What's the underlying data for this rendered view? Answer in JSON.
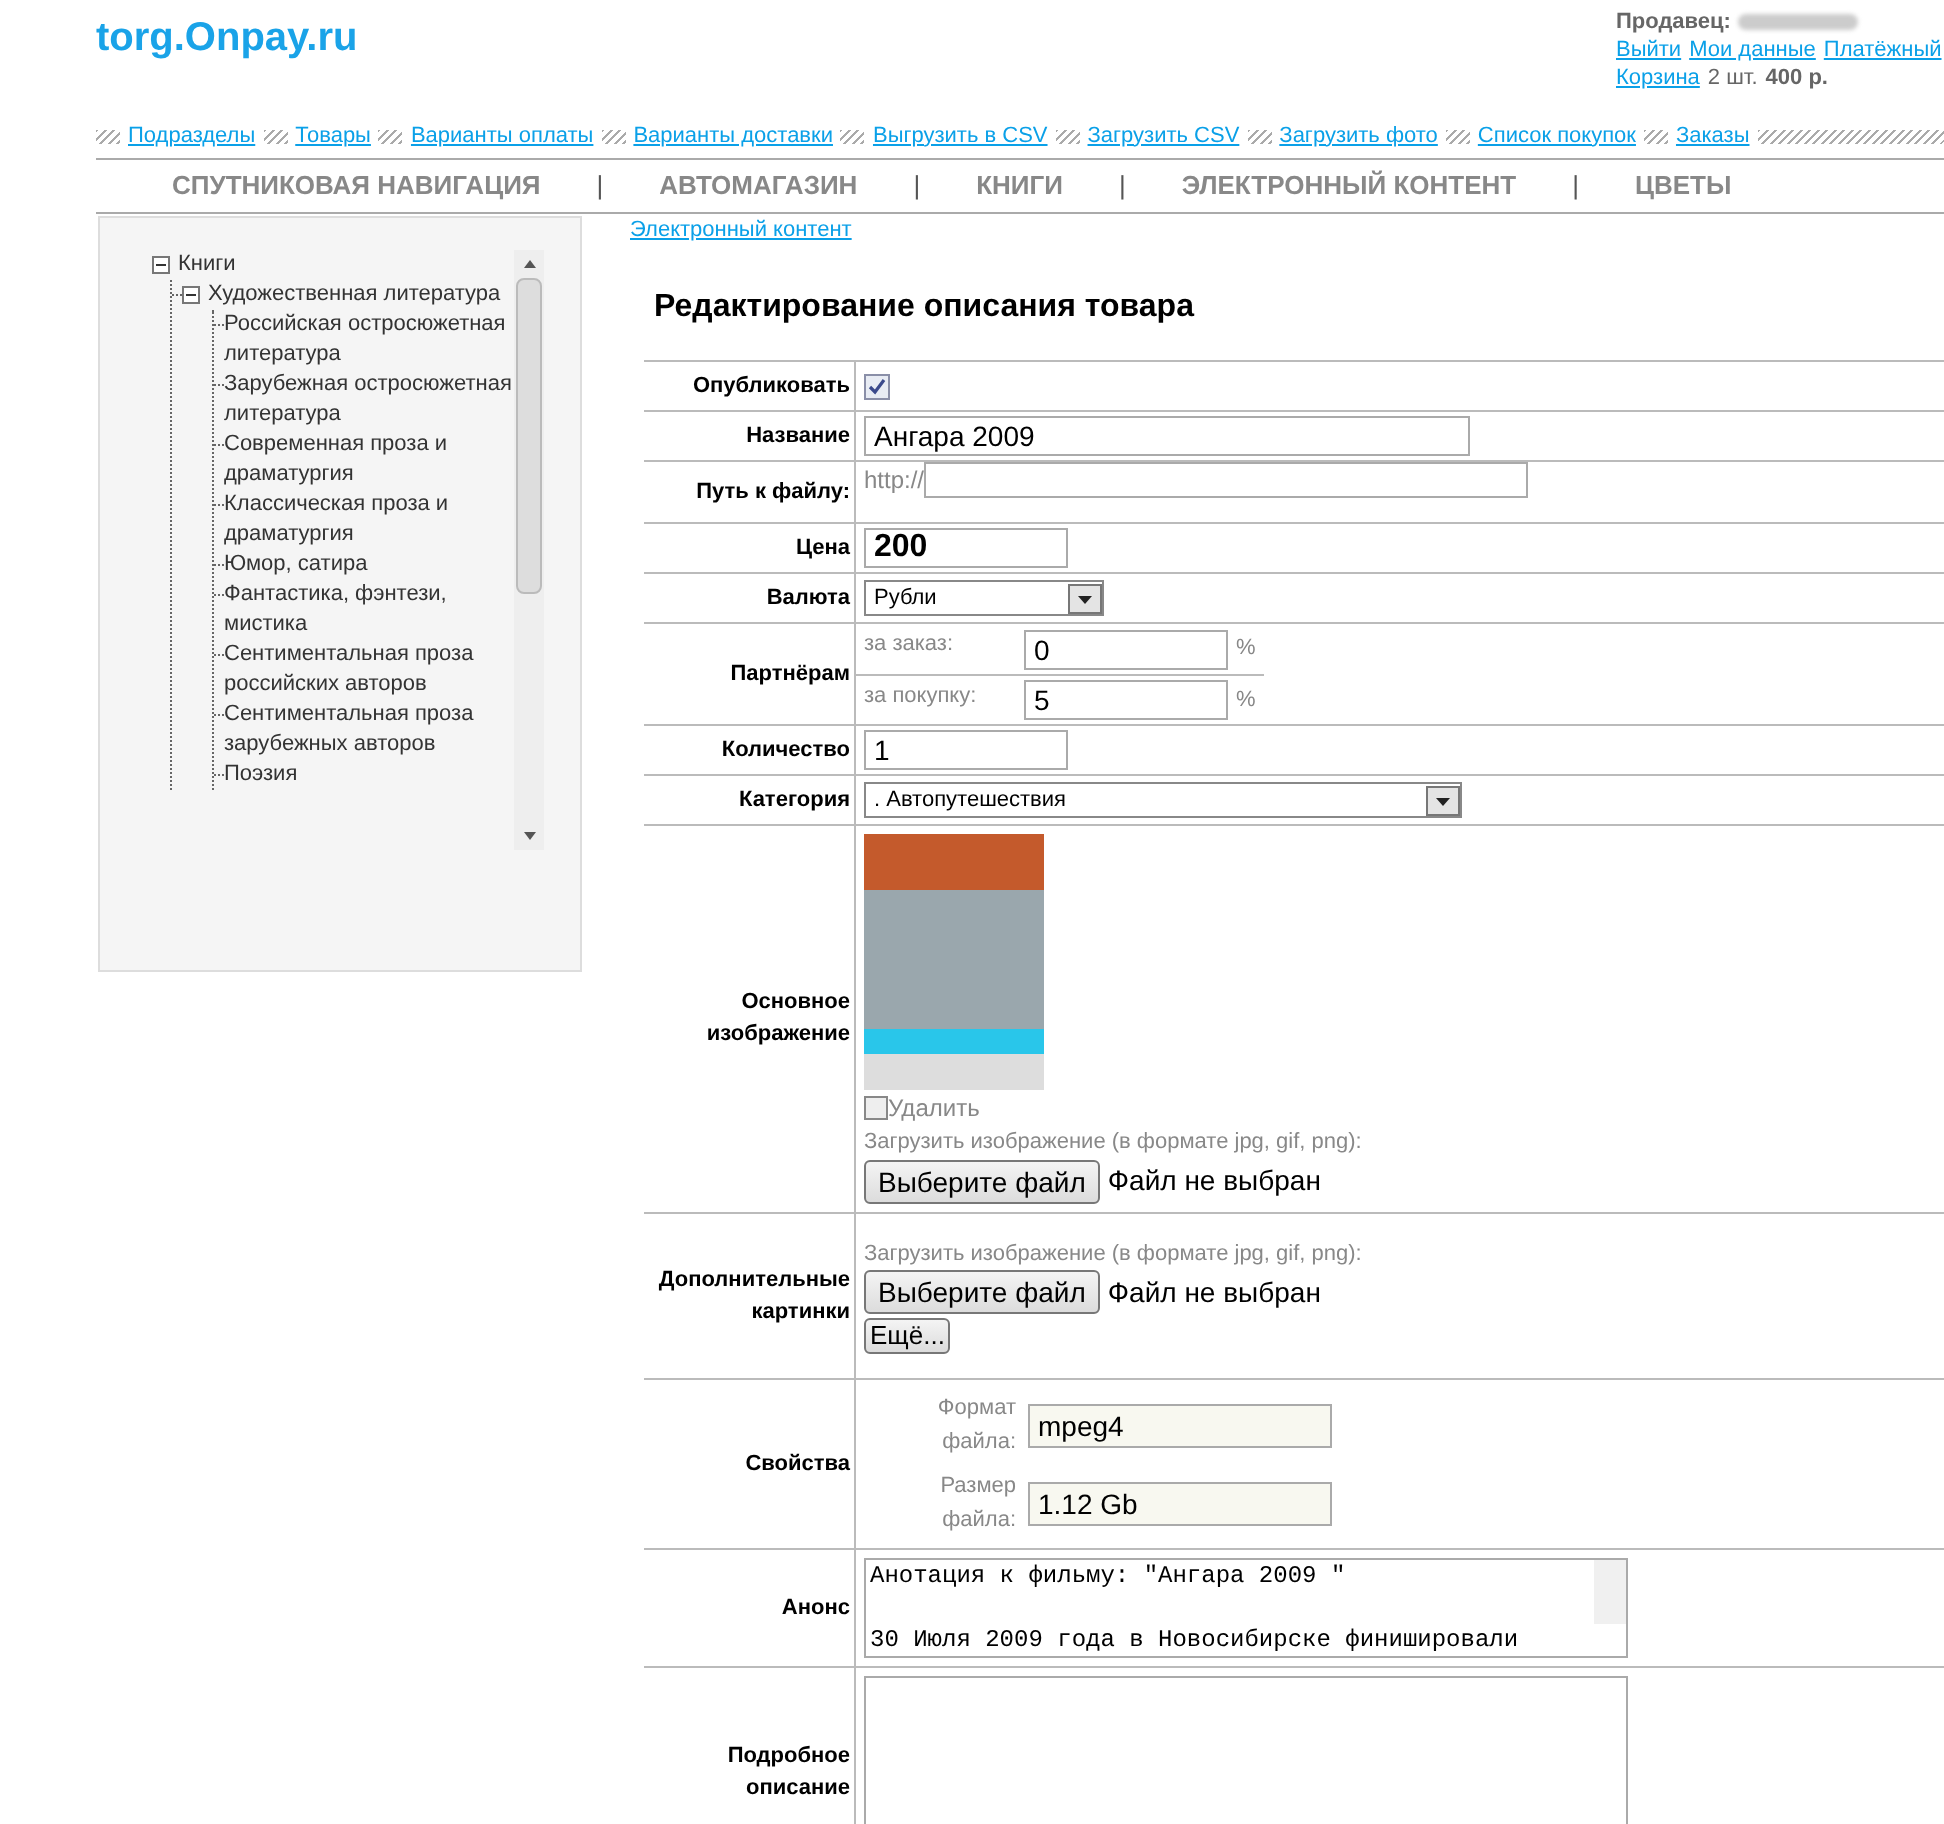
{
  "logo": "torg.Onpay.ru",
  "account": {
    "seller_label": "Продавец:",
    "links": [
      "Выйти",
      "Мои данные",
      "Платёжный"
    ],
    "cart_link": "Корзина",
    "cart_count": "2 шт.",
    "cart_total": "400 р."
  },
  "admin_links": [
    "Подразделы",
    "Товары",
    "Варианты оплаты",
    "Варианты доставки",
    "Выгрузить в CSV",
    "Загрузить CSV",
    "Загрузить фото",
    "Список покупок",
    "Заказы"
  ],
  "categories": [
    {
      "label": "СПУТНИКОВАЯ НАВИГАЦИЯ",
      "separator": "|"
    },
    {
      "label": "АВТОМАГАЗИН",
      "separator": "|"
    },
    {
      "label": "КНИГИ",
      "separator": "|"
    },
    {
      "label": "ЭЛЕКТРОННЫЙ КОНТЕНТ",
      "separator": "|"
    },
    {
      "label": "ЦВЕТЫ"
    }
  ],
  "tree": [
    {
      "label": "Книги",
      "expanded": true,
      "children": [
        {
          "label": "Художественная литература",
          "expanded": true,
          "children": [
            {
              "label": "Российская остросюжетная литература"
            },
            {
              "label": "Зарубежная остросюжетная литература"
            },
            {
              "label": "Современная проза и драматургия"
            },
            {
              "label": "Классическая проза и драматургия"
            },
            {
              "label": "Юмор, сатира"
            },
            {
              "label": "Фантастика, фэнтези, мистика"
            },
            {
              "label": "Сентиментальная проза российских авторов"
            },
            {
              "label": "Сентиментальная проза зарубежных авторов"
            },
            {
              "label": "Поэзия"
            }
          ]
        }
      ]
    }
  ],
  "breadcrumb": "Электронный контент",
  "title": "Редактирование описания товара",
  "rows": [
    {
      "label": "Опубликовать",
      "kind": "checkbox",
      "checked": true
    },
    {
      "label": "Название",
      "kind": "text",
      "value": "Ангара 2009"
    },
    {
      "label": "Путь к файлу:",
      "kind": "url",
      "prefix": "http://"
    },
    {
      "label": "Цена",
      "kind": "price",
      "value": "200"
    },
    {
      "label": "Валюта",
      "kind": "select",
      "value": "Рубли"
    },
    {
      "label": "Партнёрам",
      "kind": "pairs",
      "fields": [
        {
          "label": "за заказ:",
          "value": "0",
          "unit": "%"
        },
        {
          "label": "за покупку:",
          "value": "5",
          "unit": "%"
        }
      ]
    },
    {
      "label": "Количество",
      "kind": "short",
      "value": "1"
    },
    {
      "label": "Категория",
      "kind": "wideselect",
      "value": ". Автопутешествия"
    },
    {
      "label": "Основное изображение",
      "kind": "image",
      "delete_label": "Удалить",
      "delete_checked": false,
      "upload_hint": "Загрузить изображение (в формате jpg, gif, png):",
      "button": "Выберите файл",
      "file_status": "Файл не выбран"
    },
    {
      "label": "Дополнительные картинки",
      "kind": "images",
      "upload_hint": "Загрузить изображение (в формате jpg, gif, png):",
      "button": "Выберите файл",
      "file_status": "Файл не выбран",
      "more_button": "Ещё..."
    },
    {
      "label": "Свойства",
      "kind": "props",
      "fields": [
        {
          "label": "Формат файла:",
          "value": "mpeg4"
        },
        {
          "label": "Размер файла:",
          "value": "1.12 Gb"
        }
      ]
    },
    {
      "label": "Анонс",
      "kind": "textarea",
      "value": "Анотация к фильму: \"Ангара 2009 \"\n\n30 Июля 2009 года в Новосибирске финишировали"
    },
    {
      "label": "Подробное описание",
      "kind": "bigtextarea"
    }
  ]
}
